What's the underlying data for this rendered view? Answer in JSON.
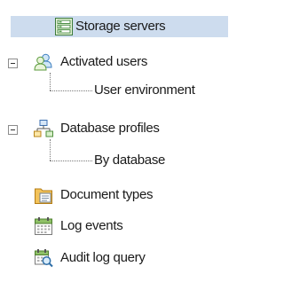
{
  "tree": {
    "items": [
      {
        "label": "Storage servers",
        "icon": "server-list-icon",
        "selected": true
      },
      {
        "label": "Activated users",
        "icon": "users-group-icon",
        "expander": "collapse"
      },
      {
        "label": "User environment",
        "child": true
      },
      {
        "label": "Database profiles",
        "icon": "network-database-icon",
        "expander": "collapse"
      },
      {
        "label": "By database",
        "child": true
      },
      {
        "label": "Document types",
        "icon": "document-types-icon"
      },
      {
        "label": "Log events",
        "icon": "log-events-icon"
      },
      {
        "label": "Audit log query",
        "icon": "audit-log-query-icon"
      }
    ]
  },
  "colors": {
    "selection": "#cddcee",
    "connector": "#7a7a7a"
  }
}
